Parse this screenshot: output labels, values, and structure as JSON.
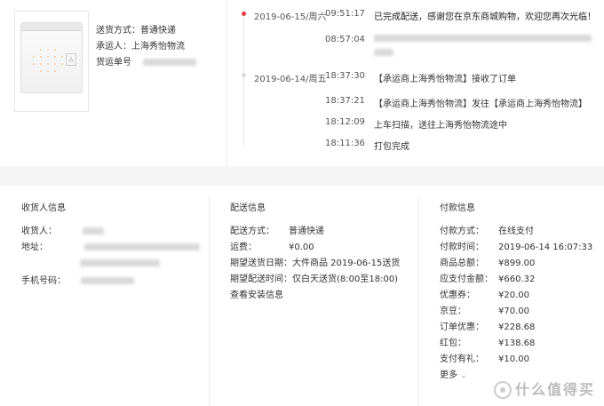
{
  "product": {
    "shipping_label": "送货方式：普通快递",
    "carrier_label": "承运人：上海秀怡物流",
    "tracking_label": "货运单号"
  },
  "logs": [
    {
      "date": "2019-06-15/周六",
      "time": "09:51:17",
      "msg": "已完成配送，感谢您在京东商城购物，欢迎您再次光临！"
    },
    {
      "date": "",
      "time": "08:57:04",
      "msg": ""
    },
    {
      "date": "2019-06-14/周五",
      "time": "18:37:30",
      "msg": "【承运商上海秀怡物流】接收了订单"
    },
    {
      "date": "",
      "time": "18:37:21",
      "msg": "【承运商上海秀怡物流】发往【承运商上海秀怡物流】"
    },
    {
      "date": "",
      "time": "18:12:09",
      "msg": "上车扫描，送往上海秀怡物流途中"
    },
    {
      "date": "",
      "time": "18:11:36",
      "msg": "打包完成"
    }
  ],
  "receiver": {
    "title": "收货人信息",
    "name_label": "收货人：",
    "address_label": "地址：",
    "phone_label": "手机号码："
  },
  "delivery": {
    "title": "配送信息",
    "method_label": "配送方式：",
    "method_value": "普通快递",
    "fee_label": "运费：",
    "fee_value": "¥0.00",
    "expected_date": "期望送货日期：大件商品 2019-06-15送货",
    "expected_time": "期望配送时间：仅白天送货(8:00至18:00)",
    "install_link": "查看安装信息"
  },
  "payment": {
    "title": "付款信息",
    "rows": [
      {
        "k": "付款方式：",
        "v": "在线支付"
      },
      {
        "k": "付款时间：",
        "v": "2019-06-14 16:07:33"
      },
      {
        "k": "商品总额：",
        "v": "¥899.00"
      },
      {
        "k": "应支付金额：",
        "v": "¥660.32"
      },
      {
        "k": "优惠券：",
        "v": "¥20.00"
      },
      {
        "k": "京豆：",
        "v": "¥70.00"
      },
      {
        "k": "订单优惠：",
        "v": "¥228.68"
      },
      {
        "k": "红包：",
        "v": "¥138.68"
      },
      {
        "k": "支付有礼：",
        "v": "¥10.00"
      }
    ],
    "more_label": "更多"
  },
  "watermark": "什么值得买",
  "colors": {
    "accent": "#e4393c",
    "band": "#f5f5f5"
  }
}
